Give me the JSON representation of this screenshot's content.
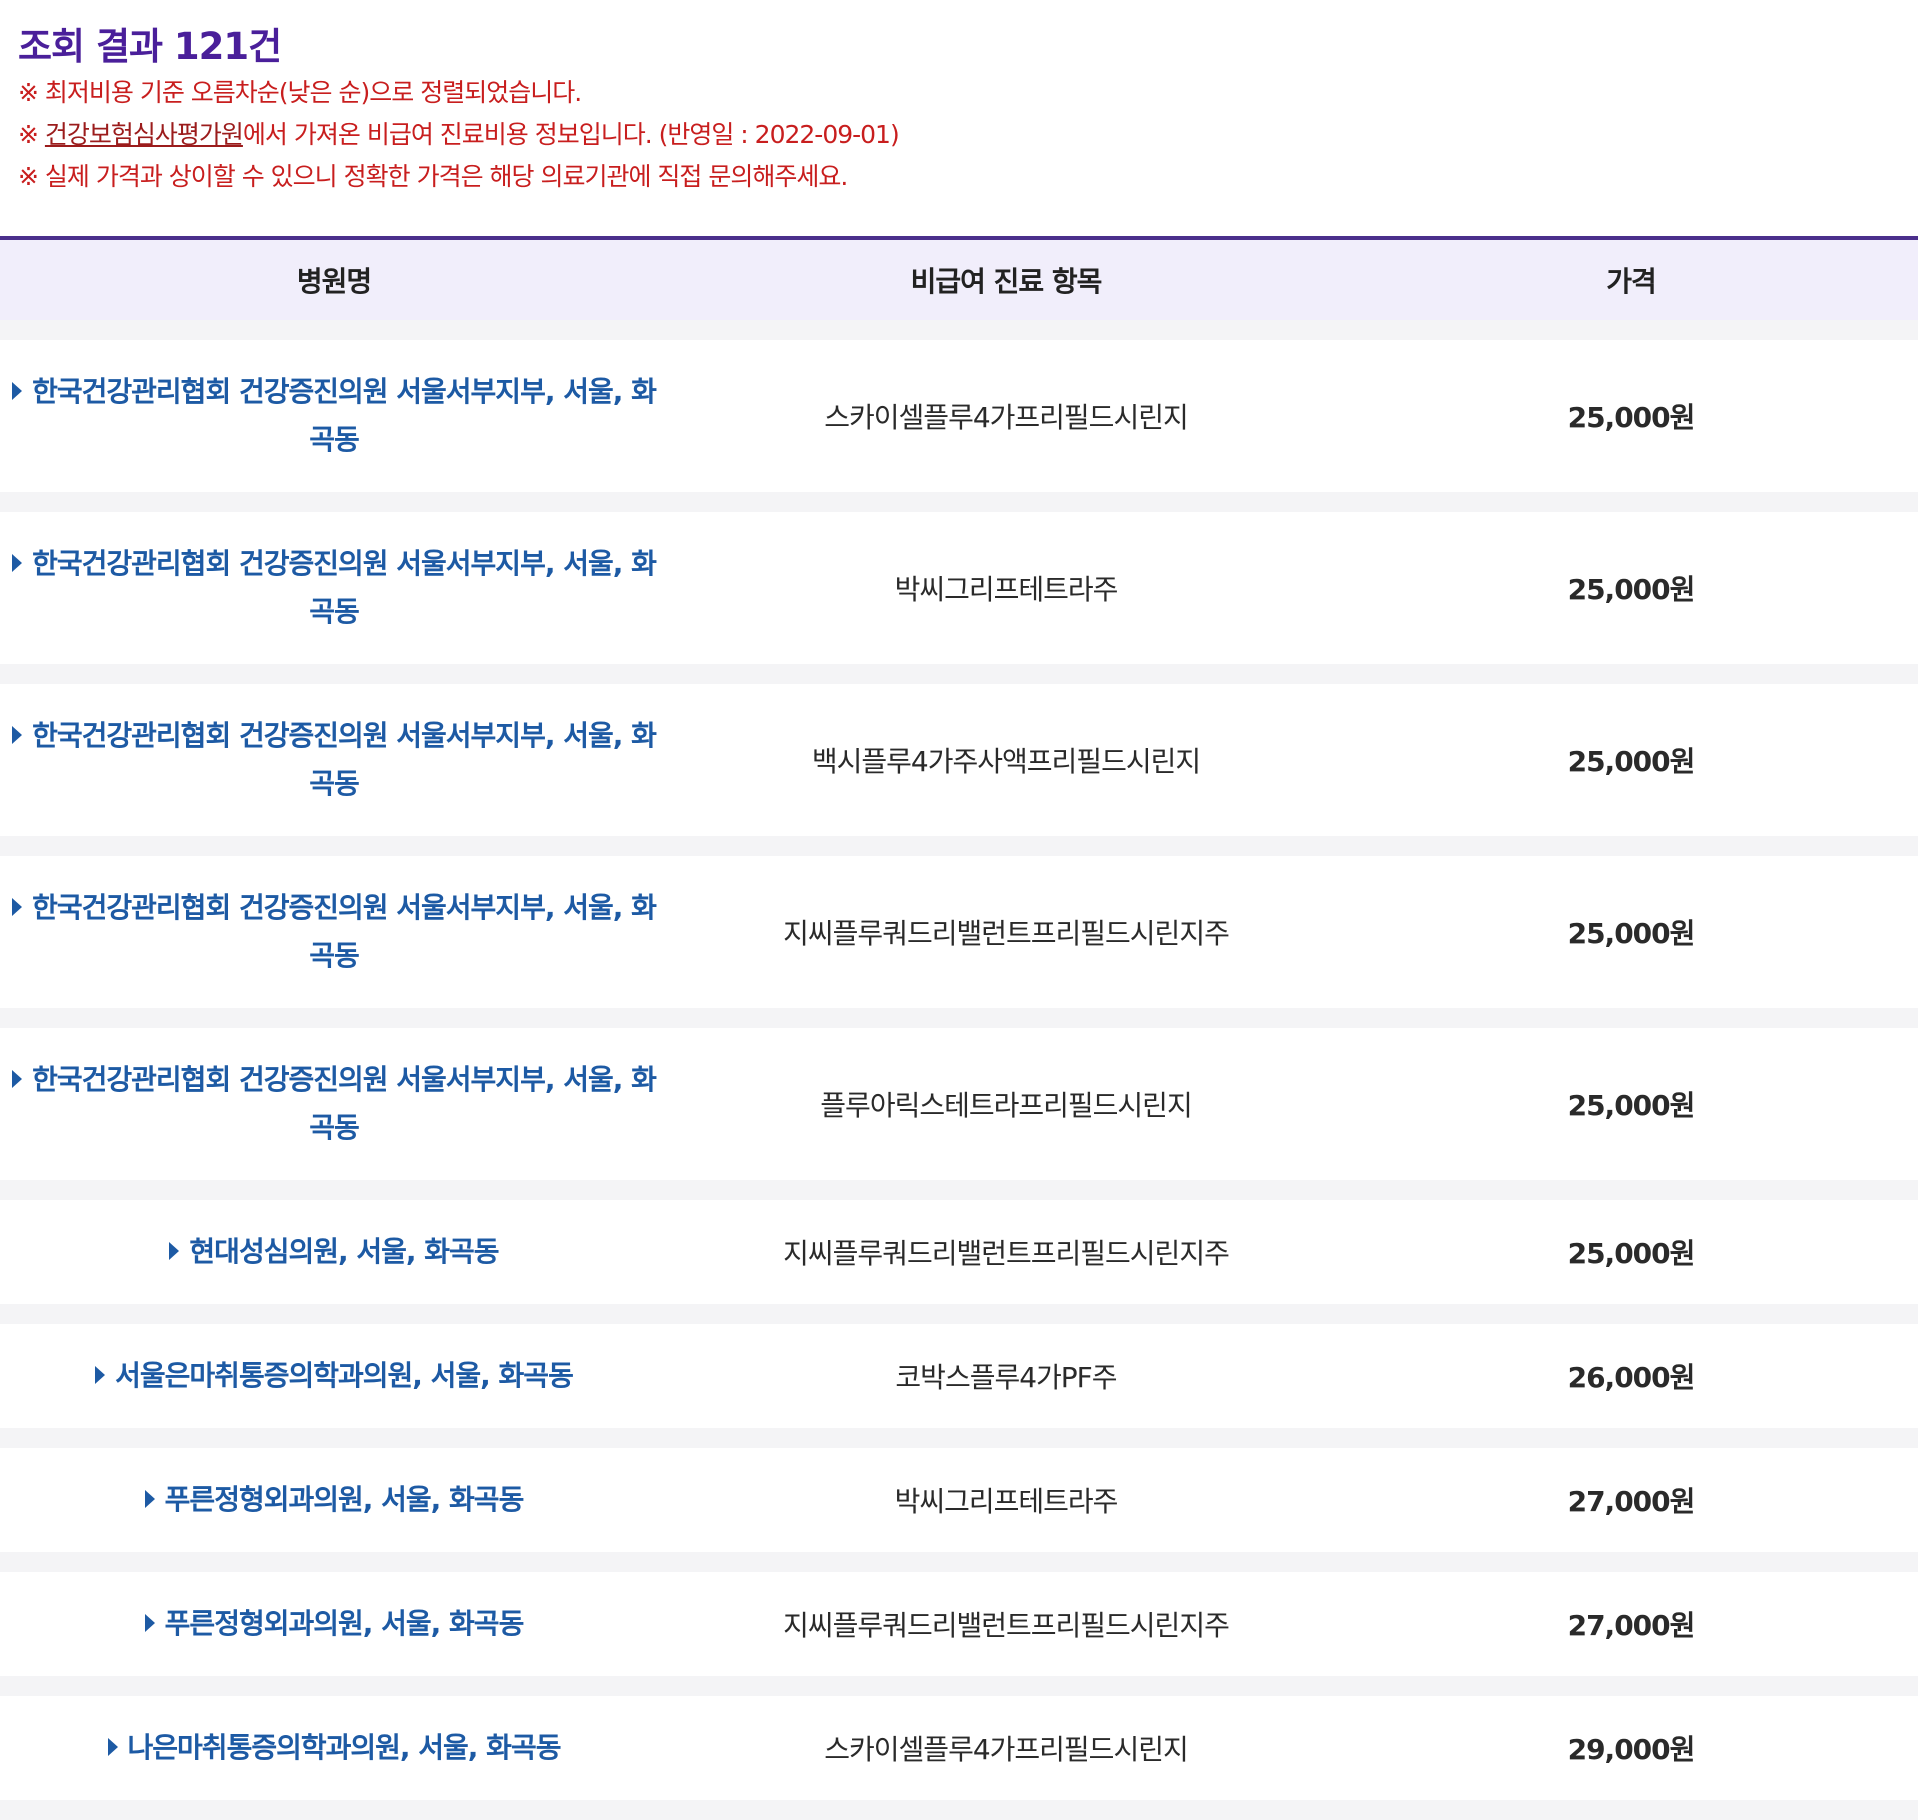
{
  "result": {
    "title": "조회 결과 121건",
    "notices": {
      "sort": "※ 최저비용 기준 오름차순(낮은 순)으로 정렬되었습니다.",
      "source_prefix": "※ ",
      "source_link": "건강보험심사평가원",
      "source_suffix": "에서 가져온 비급여 진료비용 정보입니다. (반영일 : 2022-09-01)",
      "disclaimer": "※ 실제 가격과 상이할 수 있으니 정확한 가격은 해당 의료기관에 직접 문의해주세요."
    }
  },
  "table": {
    "headers": {
      "hospital": "병원명",
      "treatment": "비급여 진료 항목",
      "price": "가격"
    },
    "rows": [
      {
        "hospital": "한국건강관리협회 건강증진의원 서울서부지부, 서울, 화곡동",
        "treatment": "스카이셀플루4가프리필드시린지",
        "price": "25,000원"
      },
      {
        "hospital": "한국건강관리협회 건강증진의원 서울서부지부, 서울, 화곡동",
        "treatment": "박씨그리프테트라주",
        "price": "25,000원"
      },
      {
        "hospital": "한국건강관리협회 건강증진의원 서울서부지부, 서울, 화곡동",
        "treatment": "백시플루4가주사액프리필드시린지",
        "price": "25,000원"
      },
      {
        "hospital": "한국건강관리협회 건강증진의원 서울서부지부, 서울, 화곡동",
        "treatment": "지씨플루쿼드리밸런트프리필드시린지주",
        "price": "25,000원"
      },
      {
        "hospital": "한국건강관리협회 건강증진의원 서울서부지부, 서울, 화곡동",
        "treatment": "플루아릭스테트라프리필드시린지",
        "price": "25,000원"
      },
      {
        "hospital": "현대성심의원, 서울, 화곡동",
        "treatment": "지씨플루쿼드리밸런트프리필드시린지주",
        "price": "25,000원"
      },
      {
        "hospital": "서울은마취통증의학과의원, 서울, 화곡동",
        "treatment": "코박스플루4가PF주",
        "price": "26,000원"
      },
      {
        "hospital": "푸른정형외과의원, 서울, 화곡동",
        "treatment": "박씨그리프테트라주",
        "price": "27,000원"
      },
      {
        "hospital": "푸른정형외과의원, 서울, 화곡동",
        "treatment": "지씨플루쿼드리밸런트프리필드시린지주",
        "price": "27,000원"
      },
      {
        "hospital": "나은마취통증의학과의원, 서울, 화곡동",
        "treatment": "스카이셀플루4가프리필드시린지",
        "price": "29,000원"
      }
    ]
  }
}
